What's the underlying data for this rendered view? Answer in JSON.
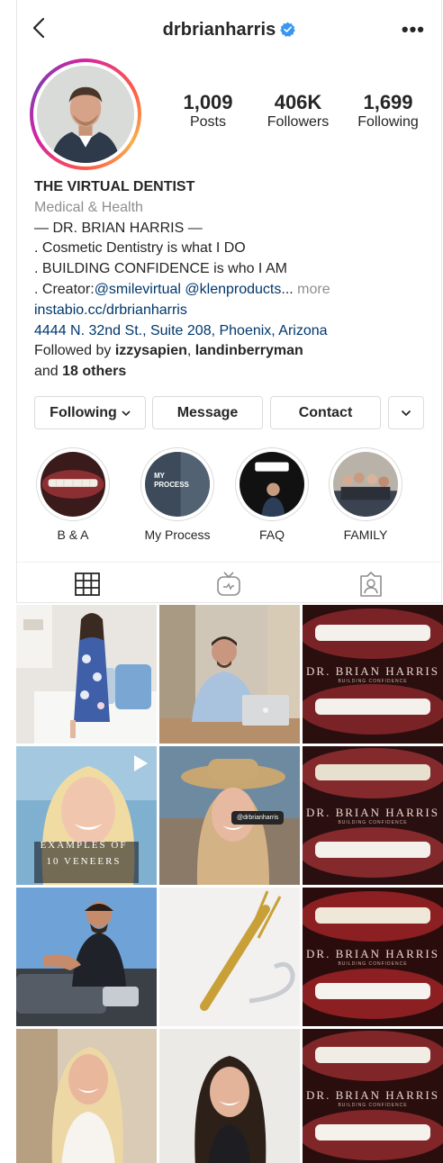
{
  "header": {
    "username": "drbrianharris"
  },
  "stats": [
    {
      "value": "1,009",
      "label": "Posts"
    },
    {
      "value": "406K",
      "label": "Followers"
    },
    {
      "value": "1,699",
      "label": "Following"
    }
  ],
  "bio": {
    "name": "THE VIRTUAL DENTIST",
    "category": "Medical & Health",
    "line1": "— DR. BRIAN HARRIS —",
    "line2": ". Cosmetic Dentistry is what I DO",
    "line3": ". BUILDING CONFIDENCE is who I AM",
    "line4_prefix": ". Creator:",
    "mention1": "@smilevirtual",
    "mention2": "@klenproducts",
    "ellipsis": "...",
    "more": "more",
    "website": "instabio.cc/drbrianharris",
    "address": "4444 N. 32nd St., Suite 208, Phoenix, Arizona",
    "followed_prefix": "Followed by",
    "follower1": "izzysapien",
    "follower2": "landinberryman",
    "and_prefix": "and",
    "others": "18 others"
  },
  "actions": {
    "following": "Following",
    "message": "Message",
    "contact": "Contact"
  },
  "highlights": [
    {
      "label": "B & A"
    },
    {
      "label": "My Process",
      "cover_text": "MY\nPROCESS"
    },
    {
      "label": "FAQ"
    },
    {
      "label": "FAMILY"
    }
  ],
  "posts": {
    "brand_title": "DR. BRIAN HARRIS",
    "brand_sub": "BUILDING CONFIDENCE",
    "veneers_line1": "EXAMPLES OF",
    "veneers_line2": "10 VENEERS",
    "tag": "@drbrianharris"
  },
  "colors": {
    "link": "#00376b",
    "secondary_text": "#8e8e8e",
    "verified": "#3897f0",
    "border": "#dbdbdb"
  },
  "icons": [
    "back-icon",
    "verified-badge-icon",
    "more-options-icon",
    "grid-icon",
    "igtv-icon",
    "tagged-icon",
    "chevron-down-icon",
    "play-icon"
  ]
}
